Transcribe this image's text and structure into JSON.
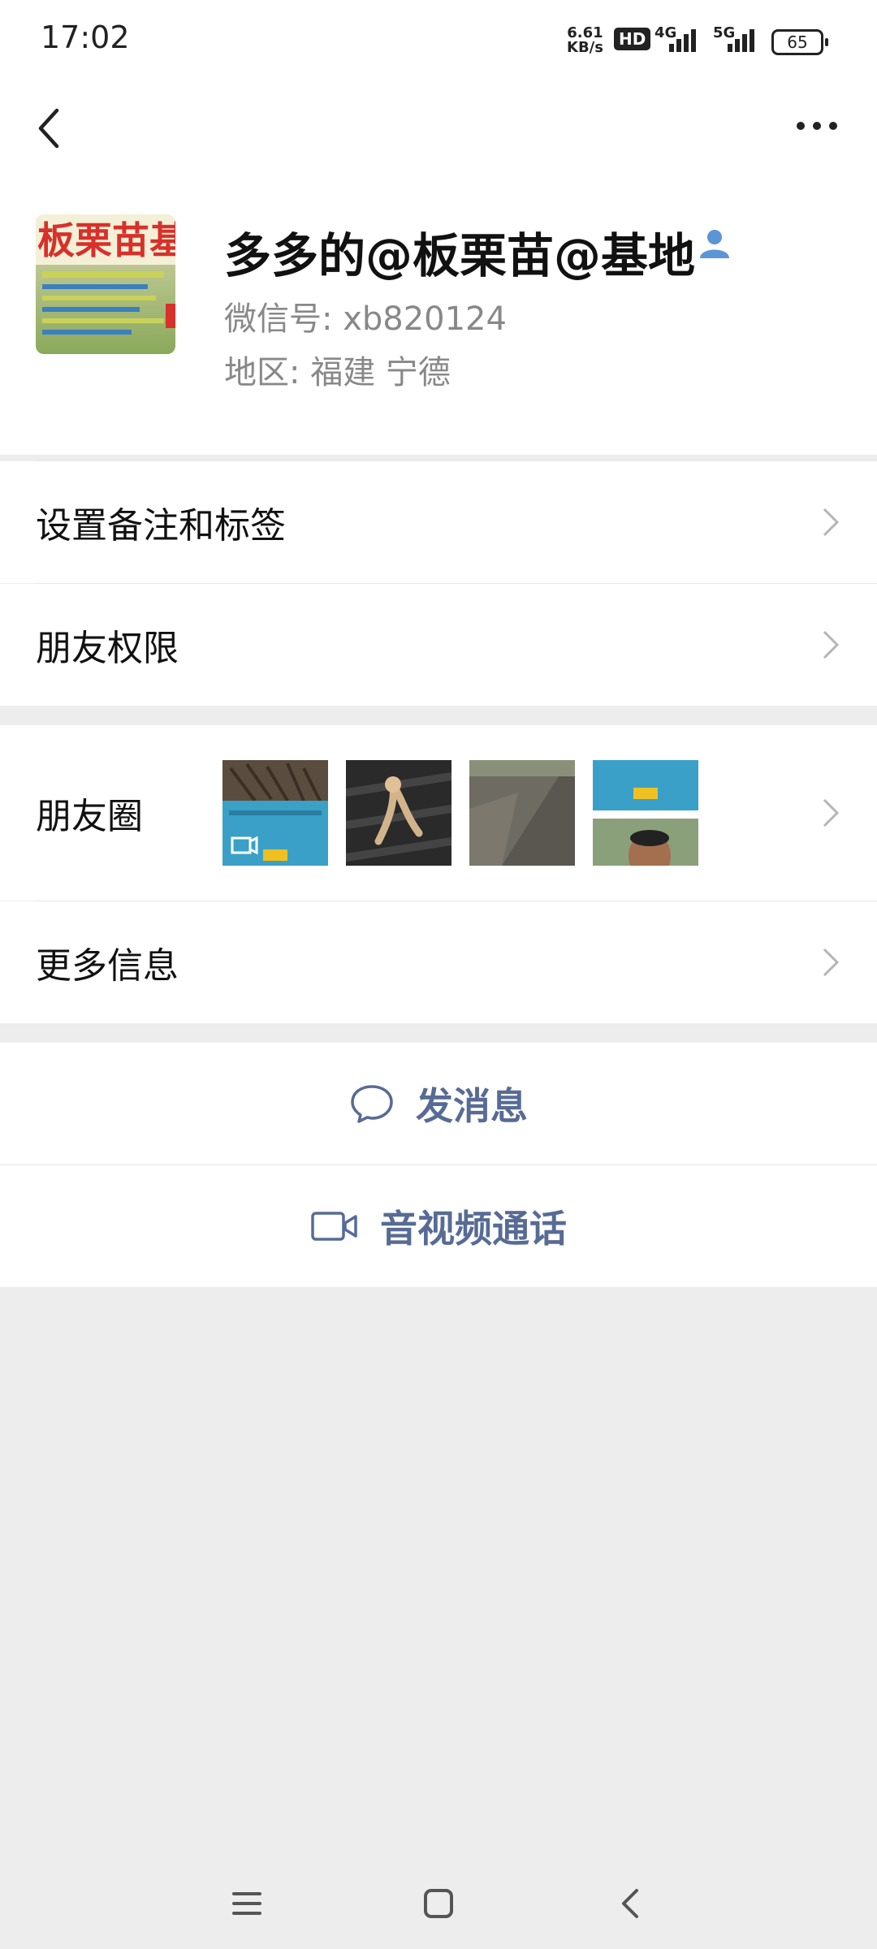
{
  "status_bar": {
    "time": "17:02",
    "net_speed_value": "6.61",
    "net_speed_unit": "KB/s",
    "hd_label": "HD",
    "signal_1": "4G",
    "signal_2": "5G",
    "battery": "65"
  },
  "profile": {
    "name": "多多的@板栗苗@基地",
    "wechat_id": "微信号:  xb820124",
    "region": "地区:  福建  宁德",
    "avatar_text": "板栗苗基"
  },
  "menu": {
    "remark_tags": "设置备注和标签",
    "friend_permissions": "朋友权限",
    "moments": "朋友圈",
    "more_info": "更多信息"
  },
  "actions": {
    "send_message": "发消息",
    "av_call": "音视频通话"
  },
  "colors": {
    "link_blue": "#576b95",
    "bg_gray": "#ededed"
  }
}
